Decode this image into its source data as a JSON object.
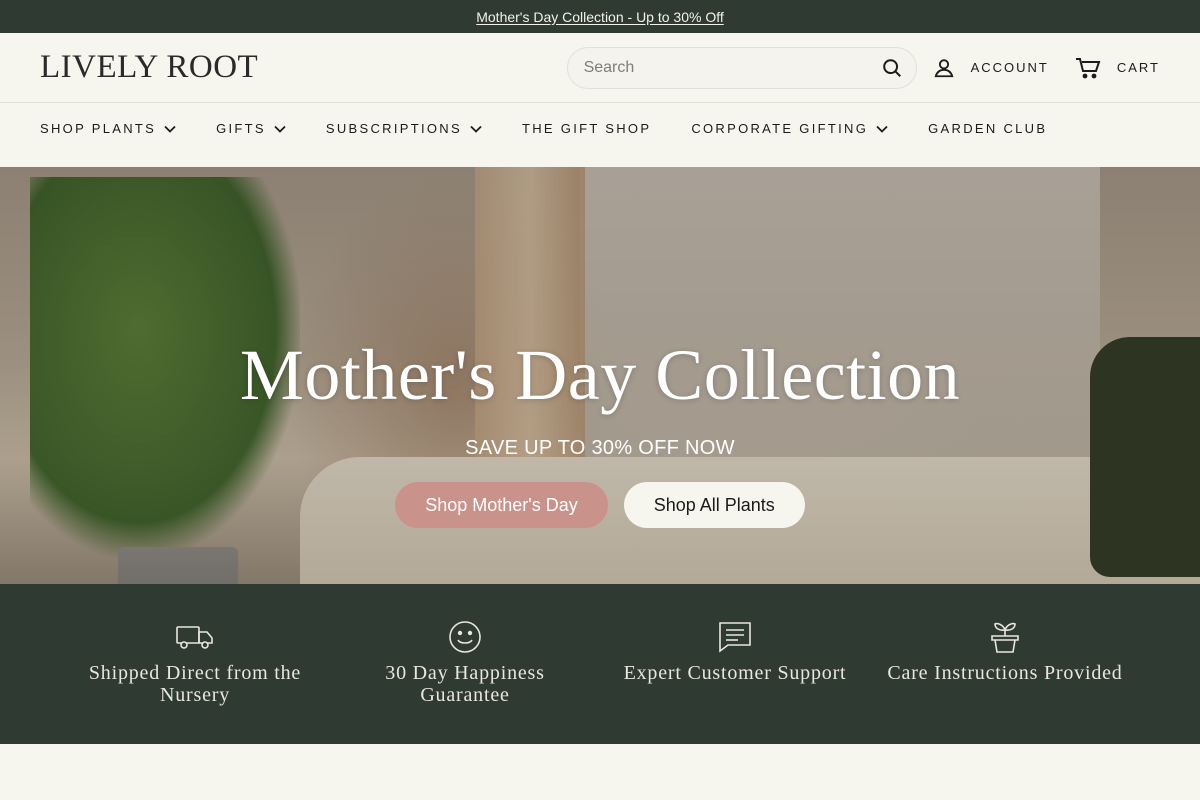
{
  "announcement": {
    "text": "Mother's Day Collection - Up to 30% Off"
  },
  "header": {
    "logo": "LIVELY ROOT",
    "search": {
      "placeholder": "Search",
      "value": ""
    },
    "account_label": "ACCOUNT",
    "cart_label": "CART"
  },
  "nav": {
    "items": [
      {
        "label": "SHOP PLANTS",
        "has_dropdown": true
      },
      {
        "label": "GIFTS",
        "has_dropdown": true
      },
      {
        "label": "SUBSCRIPTIONS",
        "has_dropdown": true
      },
      {
        "label": "THE GIFT SHOP",
        "has_dropdown": false
      },
      {
        "label": "CORPORATE GIFTING",
        "has_dropdown": true
      },
      {
        "label": "GARDEN CLUB",
        "has_dropdown": false
      }
    ]
  },
  "hero": {
    "title": "Mother's Day Collection",
    "subtitle": "SAVE UP TO 30% OFF NOW",
    "primary_button": "Shop Mother's Day",
    "secondary_button": "Shop All Plants"
  },
  "features": [
    {
      "icon": "truck-icon",
      "text": "Shipped Direct from the Nursery"
    },
    {
      "icon": "smile-icon",
      "text": "30 Day Happiness Guarantee"
    },
    {
      "icon": "chat-icon",
      "text": "Expert Customer Support"
    },
    {
      "icon": "plant-pot-icon",
      "text": "Care Instructions Provided"
    }
  ],
  "colors": {
    "dark_green": "#2f3b32",
    "cream": "#f6f5ee",
    "accent_pink": "#c9928a"
  }
}
